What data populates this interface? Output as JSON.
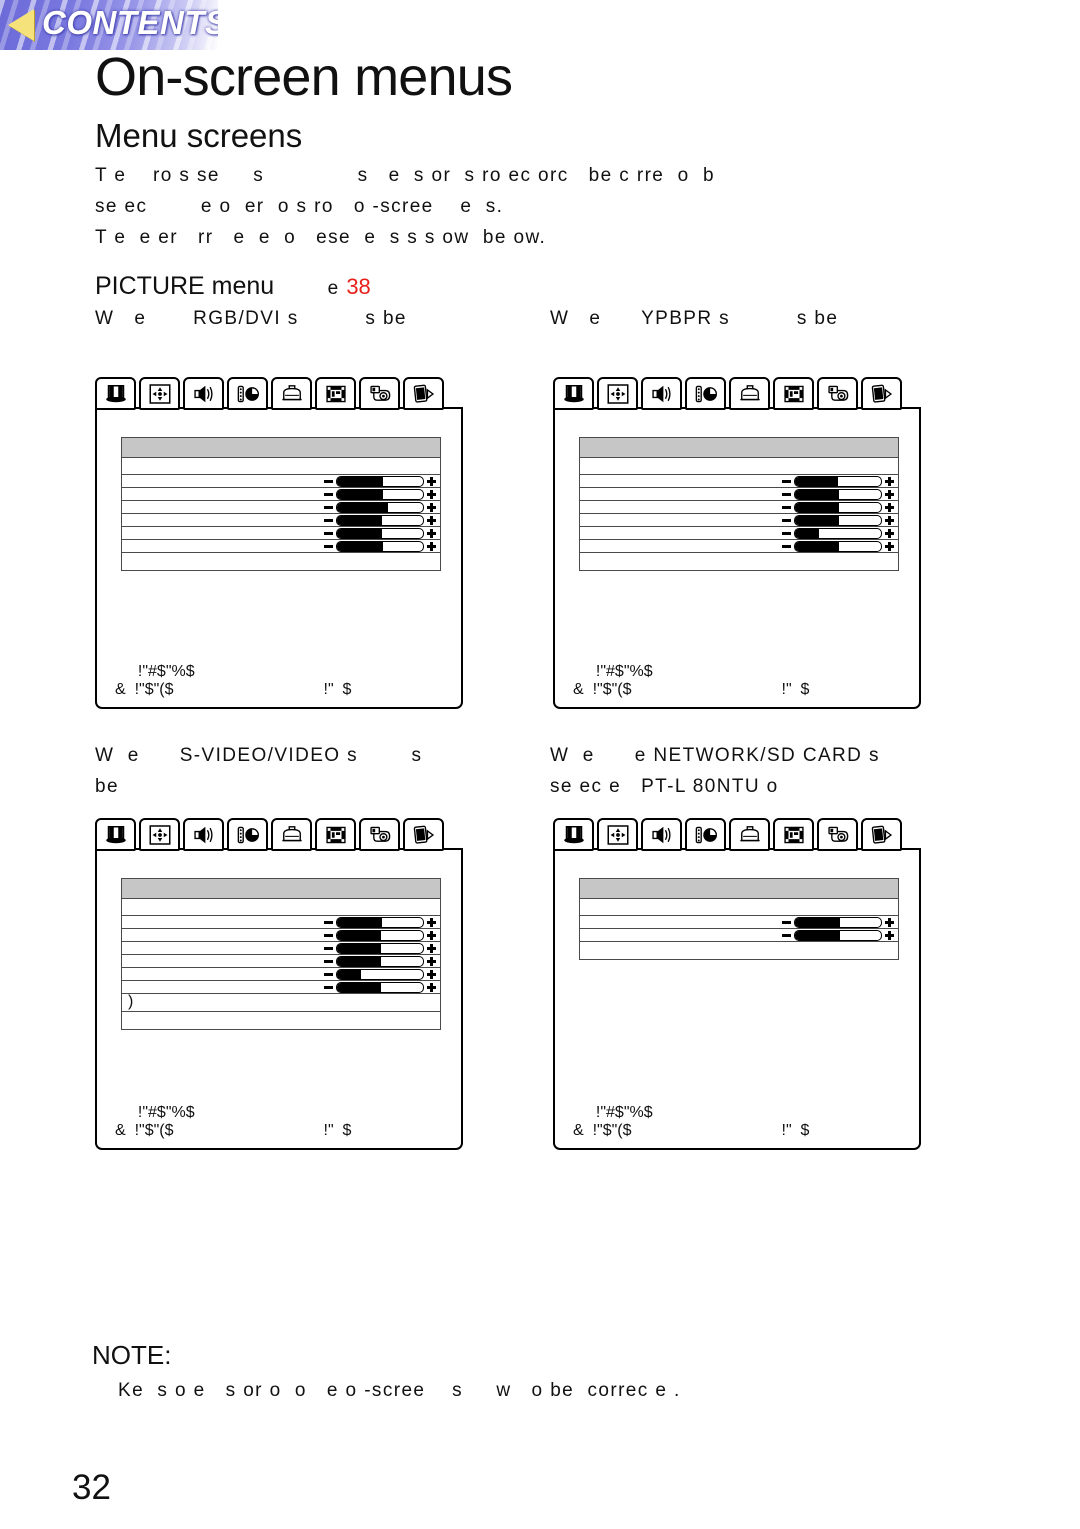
{
  "banner": {
    "label": "CONTENTS",
    "triangle_color": "#f6e27a",
    "bg_color": "#6b6ad8"
  },
  "page": {
    "title": "On-screen menus",
    "section_title": "Menu screens",
    "page_number": "32"
  },
  "intro": {
    "line1": "T e    ro s se     s              s   e  s or  s ro ec orc   be c rre  o  b",
    "line2": "se ec        e o  er  o s ro   o -scree    e  s.",
    "line3": "T e  e er   rr   e  e  o   ese  e  s s s ow  be ow."
  },
  "picture_menu": {
    "label": "PICTURE menu",
    "ref_prefix": "e",
    "ref_page": "38"
  },
  "captions": {
    "rgb_dvi": "W   e       RGB/DVI s          s be",
    "ypbpr": "W   e      YPBPR s          s be",
    "svideo_line1": "W  e      S-VIDEO/VIDEO s        s",
    "svideo_line2": "be",
    "network_line1": "W  e      e NETWORK/SD CARD s",
    "network_line2": "se ec e   PT-L 80NTU o"
  },
  "osd_tabs": [
    {
      "name": "picture-tab",
      "icon": "picture-contrast-icon",
      "active": true
    },
    {
      "name": "position-tab",
      "icon": "position-arrows-icon",
      "active": false
    },
    {
      "name": "audio-tab",
      "icon": "speaker-icon",
      "active": false
    },
    {
      "name": "timer-tab",
      "icon": "timer-icon",
      "active": false
    },
    {
      "name": "lamp-tab",
      "icon": "lamp-housing-icon",
      "active": false
    },
    {
      "name": "shift-tab",
      "icon": "shift-frame-icon",
      "active": false
    },
    {
      "name": "network-tab",
      "icon": "network-camera-icon",
      "active": false
    },
    {
      "name": "card-tab",
      "icon": "sd-card-play-icon",
      "active": false
    }
  ],
  "osd_footer": {
    "line1": "!\"#$\"%$",
    "line2_left": "&  !\"$\"($",
    "line2_right": "!\"  $"
  },
  "osd_panels": [
    {
      "id": "osd-rgb-dvi",
      "name": "osd-panel-rgb-dvi",
      "rows": [
        {
          "type": "header"
        },
        {
          "type": "blank"
        },
        {
          "type": "slider",
          "value": 54
        },
        {
          "type": "slider",
          "value": 54
        },
        {
          "type": "slider",
          "value": 59
        },
        {
          "type": "slider",
          "value": 52
        },
        {
          "type": "slider",
          "value": 52
        },
        {
          "type": "slider",
          "value": 53
        },
        {
          "type": "footer"
        }
      ]
    },
    {
      "id": "osd-ypbpr",
      "name": "osd-panel-ypbpr",
      "rows": [
        {
          "type": "header"
        },
        {
          "type": "blank"
        },
        {
          "type": "slider",
          "value": 50
        },
        {
          "type": "slider",
          "value": 51
        },
        {
          "type": "slider",
          "value": 51
        },
        {
          "type": "slider",
          "value": 51
        },
        {
          "type": "slider",
          "value": 28
        },
        {
          "type": "slider",
          "value": 51
        },
        {
          "type": "footer"
        }
      ]
    },
    {
      "id": "osd-svideo-video",
      "name": "osd-panel-svideo-video",
      "rows": [
        {
          "type": "header"
        },
        {
          "type": "blank"
        },
        {
          "type": "slider",
          "value": 52
        },
        {
          "type": "slider",
          "value": 51
        },
        {
          "type": "slider",
          "value": 51
        },
        {
          "type": "slider",
          "value": 51
        },
        {
          "type": "slider",
          "value": 28
        },
        {
          "type": "slider",
          "value": 51
        },
        {
          "type": "tall",
          "mark": ")"
        },
        {
          "type": "footer"
        }
      ]
    },
    {
      "id": "osd-network-sdcard",
      "name": "osd-panel-network-sdcard",
      "rows": [
        {
          "type": "header"
        },
        {
          "type": "blank"
        },
        {
          "type": "slider",
          "value": 52
        },
        {
          "type": "slider",
          "value": 52
        },
        {
          "type": "footer"
        }
      ]
    }
  ],
  "note": {
    "label": "NOTE:",
    "body": "Ke  s o e   s or o  o   e o -scree    s     w   o be  correc e ."
  }
}
